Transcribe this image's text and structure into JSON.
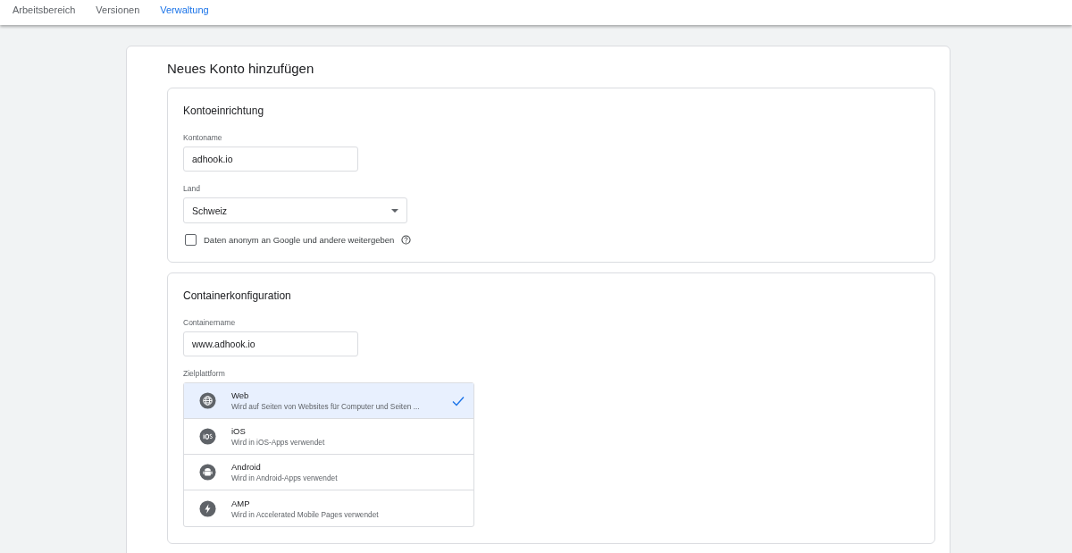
{
  "nav": {
    "tabs": [
      {
        "label": "Arbeitsbereich",
        "selected": false
      },
      {
        "label": "Versionen",
        "selected": false
      },
      {
        "label": "Verwaltung",
        "selected": true
      }
    ]
  },
  "page_title": "Neues Konto hinzufügen",
  "account_setup": {
    "title": "Kontoeinrichtung",
    "account_name": {
      "label": "Kontoname",
      "value": "adhook.io"
    },
    "country": {
      "label": "Land",
      "value": "Schweiz"
    },
    "share_data": {
      "label": "Daten anonym an Google und andere weitergeben",
      "checked": false
    }
  },
  "container_setup": {
    "title": "Containerkonfiguration",
    "container_name": {
      "label": "Containername",
      "value": "www.adhook.io"
    },
    "platform_label": "Zielplattform",
    "platforms": [
      {
        "kind": "web",
        "name": "Web",
        "description": "Wird auf Seiten von Websites für Computer und Seiten ...",
        "selected": true
      },
      {
        "kind": "ios",
        "name": "iOS",
        "description": "Wird in iOS-Apps verwendet",
        "selected": false
      },
      {
        "kind": "android",
        "name": "Android",
        "description": "Wird in Android-Apps verwendet",
        "selected": false
      },
      {
        "kind": "amp",
        "name": "AMP",
        "description": "Wird in Accelerated Mobile Pages verwendet",
        "selected": false
      }
    ]
  }
}
